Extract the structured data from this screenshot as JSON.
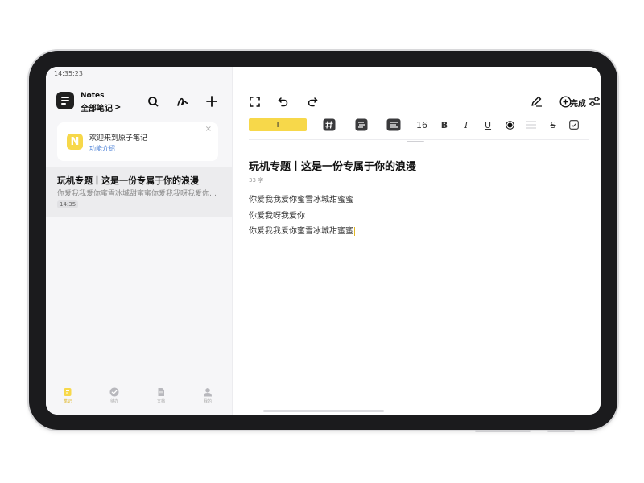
{
  "status_bar": {
    "time": "14:35:23"
  },
  "sidebar": {
    "app_title": "Notes",
    "folder_label": "全部笔记",
    "folder_chevron": ">",
    "welcome_card": {
      "logo_letter": "N",
      "title": "欢迎来到原子笔记",
      "link": "功能介绍",
      "close": "×"
    },
    "notes": [
      {
        "title": "玩机专题丨这是一份专属于你的浪漫",
        "preview": "你爱我我爱你蜜雪冰城甜蜜蜜你爱我我呀我爱你…",
        "time": "14:35"
      }
    ],
    "bottom_nav": [
      {
        "label": "笔记",
        "icon": "note-icon",
        "active": true
      },
      {
        "label": "待办",
        "icon": "check-circle-icon",
        "active": false
      },
      {
        "label": "文档",
        "icon": "document-icon",
        "active": false
      },
      {
        "label": "我的",
        "icon": "person-icon",
        "active": false
      }
    ]
  },
  "editor": {
    "done_label": "完成",
    "format_bar": {
      "text_style": "T",
      "font_size": "16",
      "bold": "B",
      "italic": "I",
      "underline": "U",
      "strikethrough": "S"
    },
    "note_title": "玩机专题丨这是一份专属于你的浪漫",
    "word_count": "33 字",
    "body_lines": [
      "你爱我我爱你蜜雪冰城甜蜜蜜",
      "你爱我呀我爱你",
      "你爱我我爱你蜜雪冰城甜蜜蜜"
    ]
  },
  "colors": {
    "accent": "#f7d84a",
    "link": "#4a7fd6",
    "bezel": "#1b1b1d",
    "sidebar_bg": "#f6f6f8",
    "selected_item_bg": "#ececee"
  }
}
